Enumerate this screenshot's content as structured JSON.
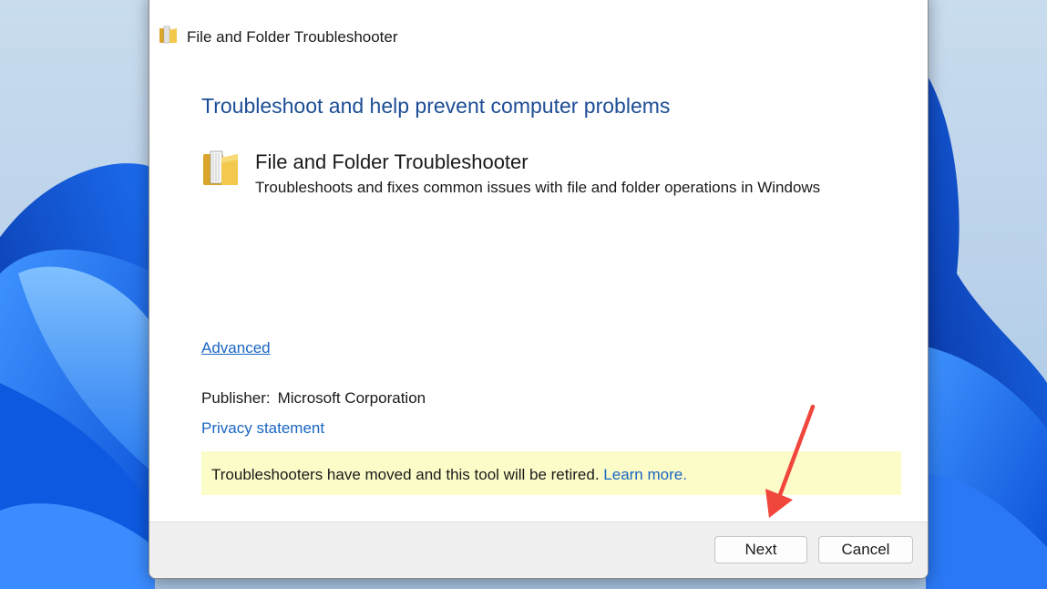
{
  "window": {
    "title": "File and Folder Troubleshooter",
    "title_icon": "folder-icon"
  },
  "main": {
    "headline": "Troubleshoot and help prevent computer problems",
    "tool_icon": "folder-icon",
    "tool_name": "File and Folder Troubleshooter",
    "tool_description": "Troubleshoots and fixes common issues with file and folder operations in Windows",
    "advanced_link": "Advanced",
    "publisher_label": "Publisher:",
    "publisher_value": "Microsoft Corporation",
    "privacy_link": "Privacy statement"
  },
  "notice": {
    "text": "Troubleshooters have moved and this tool will be retired.",
    "link": "Learn more."
  },
  "footer": {
    "next_label": "Next",
    "cancel_label": "Cancel"
  },
  "colors": {
    "headline": "#1d4d96",
    "link": "#1a66c2",
    "notice_bg": "#fcfcc8",
    "annotation_arrow": "#f0463c"
  }
}
